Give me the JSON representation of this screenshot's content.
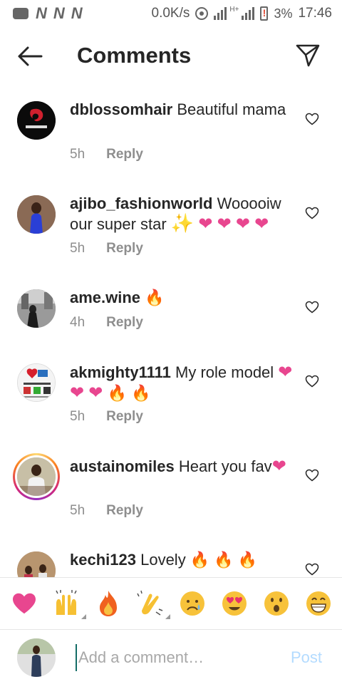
{
  "status_bar": {
    "net_speed": "0.0K/s",
    "network_type": "H+",
    "battery": "3%",
    "time": "17:46"
  },
  "header": {
    "title": "Comments"
  },
  "comments": [
    {
      "username": "dblossomhair",
      "text": "Beautiful mama",
      "emojis": [],
      "time": "5h",
      "reply": "Reply"
    },
    {
      "username": "ajibo_fashionworld",
      "text": "Wooooiw our super star",
      "emojis": [
        "✨",
        "❤",
        "❤",
        "❤",
        "❤"
      ],
      "time": "5h",
      "reply": "Reply"
    },
    {
      "username": "ame.wine",
      "text": "",
      "emojis": [
        "🔥"
      ],
      "time": "4h",
      "reply": "Reply"
    },
    {
      "username": "akmighty1111",
      "text": "My role model",
      "emojis": [
        "❤",
        "❤",
        "❤",
        "🔥",
        "🔥"
      ],
      "time": "5h",
      "reply": "Reply"
    },
    {
      "username": "austainomiles",
      "text": "Heart you fav",
      "emojis": [
        "❤"
      ],
      "time": "5h",
      "reply": "Reply"
    },
    {
      "username": "kechi123",
      "text": "Lovely",
      "emojis": [
        "🔥",
        "🔥",
        "🔥"
      ],
      "time": "",
      "reply": ""
    }
  ],
  "emoji_bar": {
    "items": [
      "heart",
      "raised-hands",
      "fire",
      "clapping-hands",
      "sad-face",
      "heart-eyes-face",
      "surprised-face",
      "grinning-face"
    ]
  },
  "composer": {
    "placeholder": "Add a comment…",
    "post_label": "Post"
  },
  "colors": {
    "accent_blue_disabled": "#b3dbff",
    "heart_pink": "#e8468f",
    "text": "#262626",
    "muted": "#8e8e8e"
  }
}
